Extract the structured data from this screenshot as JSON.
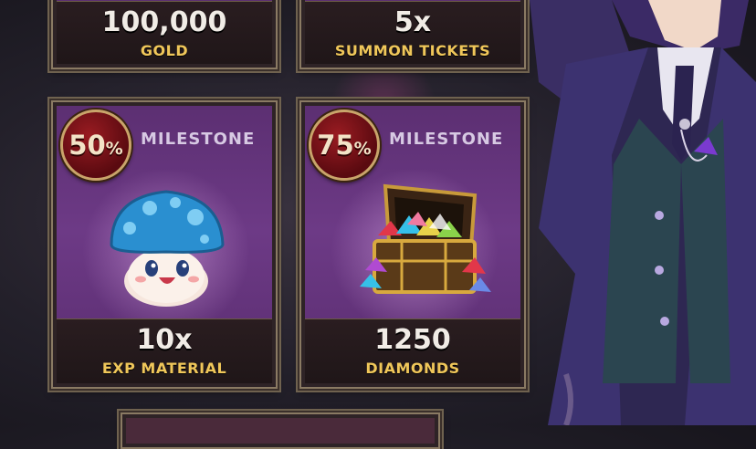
{
  "rewards": [
    {
      "amount": "100,000",
      "label": "GOLD"
    },
    {
      "amount": "5x",
      "label": "SUMMON TICKETS"
    },
    {
      "milestone_percent": "50",
      "percent_sign": "%",
      "milestone_label": "MILESTONE",
      "amount": "10x",
      "label": "EXP MATERIAL",
      "icon": "mushroom-icon"
    },
    {
      "milestone_percent": "75",
      "percent_sign": "%",
      "milestone_label": "MILESTONE",
      "amount": "1250",
      "label": "DIAMONDS",
      "icon": "treasure-chest-icon"
    }
  ],
  "colors": {
    "card_purple": "#6d3a86",
    "label_gold": "#f0c75a",
    "milestone_badge": "#9a1c22",
    "frame": "#8a7a63"
  }
}
